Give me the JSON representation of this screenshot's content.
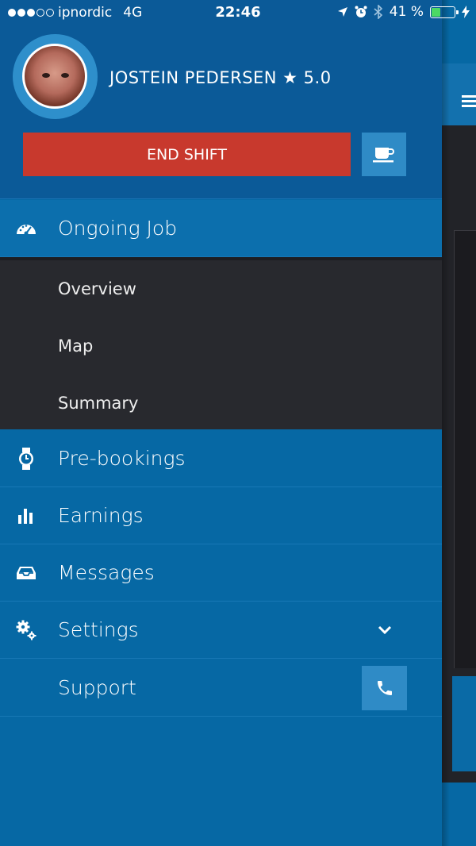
{
  "status_bar": {
    "carrier": "ipnordic",
    "network": "4G",
    "time": "22:46",
    "battery": "41 %",
    "battery_level": 0.41
  },
  "profile": {
    "name": "JOSTEIN PEDERSEN ★ 5.0"
  },
  "actions": {
    "end_shift_label": "END SHIFT",
    "break_icon": "coffee-cup-icon"
  },
  "menu": {
    "ongoing_job": "Ongoing Job",
    "submenu": [
      "Overview",
      "Map",
      "Summary"
    ],
    "prebookings": "Pre-bookings",
    "earnings": "Earnings",
    "messages": "Messages",
    "settings": "Settings",
    "support": "Support"
  },
  "colors": {
    "drawer_bg": "#0668a4",
    "header_bg": "#0b5a98",
    "end_shift": "#c8392d",
    "accent_button": "#2f8bc6",
    "submenu_bg": "#28292e"
  }
}
